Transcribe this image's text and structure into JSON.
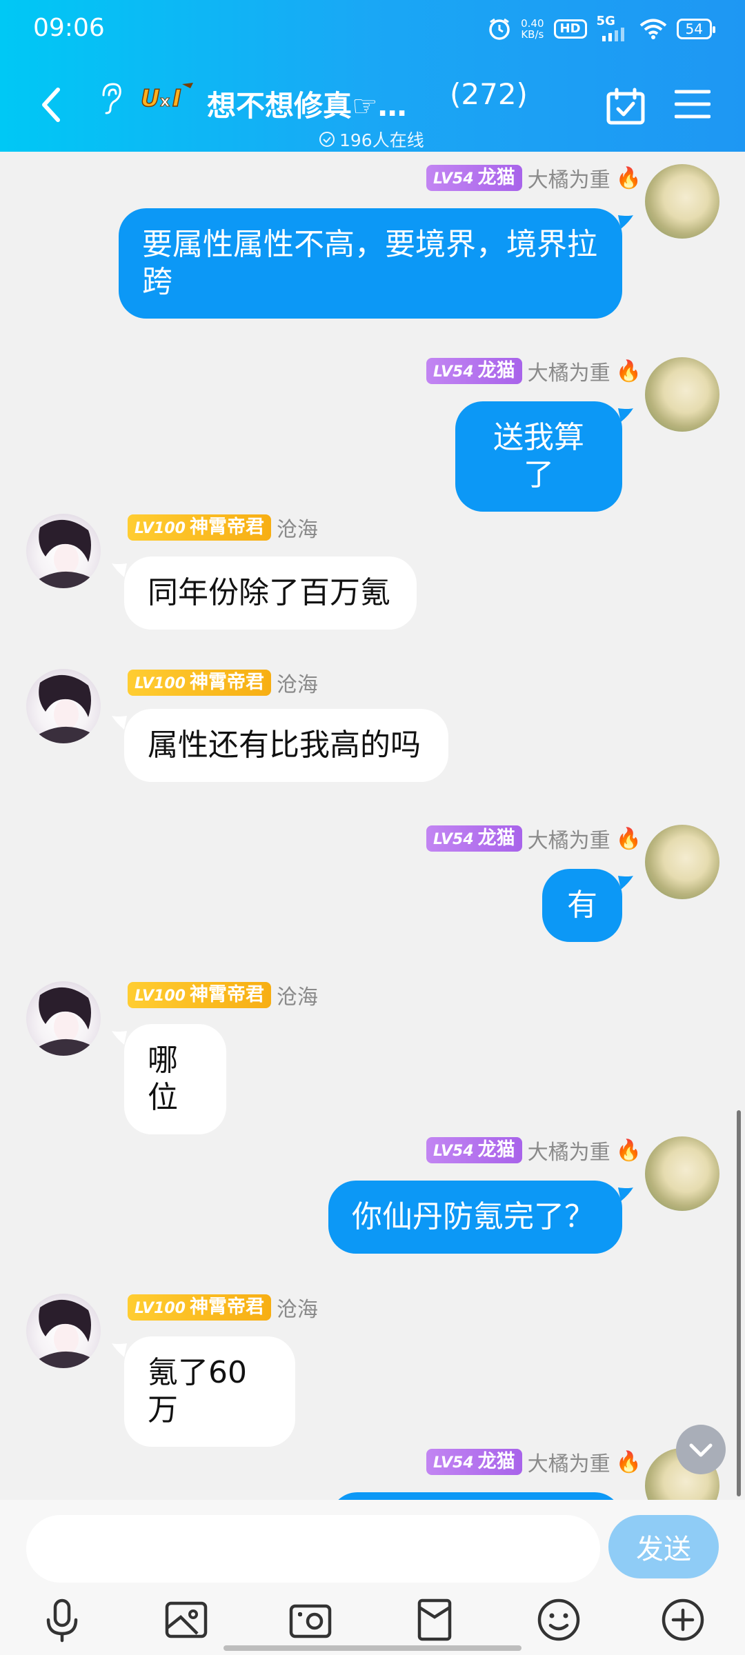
{
  "status_bar": {
    "time": "09:06",
    "net_speed_value": "0.40",
    "net_speed_unit": "KB/s",
    "hd_label": "HD",
    "signal_label": "5G",
    "battery": "54"
  },
  "header": {
    "group_title": "想不想修真☞…",
    "member_count": "(272)",
    "online_count": "196人在线",
    "logo_text": "UxI"
  },
  "messages": [
    {
      "side": "out",
      "level": "LV54",
      "title": "龙猫",
      "name": "大橘为重",
      "text": "要属性属性不高，要境界，境界拉跨"
    },
    {
      "side": "out",
      "level": "LV54",
      "title": "龙猫",
      "name": "大橘为重",
      "text": "送我算了"
    },
    {
      "side": "in",
      "level": "LV100",
      "title": "神霄帝君",
      "name": "沧海",
      "text": "同年份除了百万氪"
    },
    {
      "side": "in",
      "level": "LV100",
      "title": "神霄帝君",
      "name": "沧海",
      "text": "属性还有比我高的吗"
    },
    {
      "side": "out",
      "level": "LV54",
      "title": "龙猫",
      "name": "大橘为重",
      "text": "有"
    },
    {
      "side": "in",
      "level": "LV100",
      "title": "神霄帝君",
      "name": "沧海",
      "text": "哪位"
    },
    {
      "side": "out",
      "level": "LV54",
      "title": "龙猫",
      "name": "大橘为重",
      "text": "你仙丹防氪完了？"
    },
    {
      "side": "in",
      "level": "LV100",
      "title": "神霄帝君",
      "name": "沧海",
      "text": "氪了60万"
    },
    {
      "side": "out",
      "level": "LV54",
      "title": "龙猫",
      "name": "大橘为重",
      "text": ""
    }
  ],
  "input": {
    "placeholder": "",
    "value": "",
    "send_label": "发送"
  },
  "toolbar": [
    "mic-icon",
    "image-icon",
    "camera-icon",
    "red-packet-icon",
    "emoji-icon",
    "plus-icon"
  ],
  "colors": {
    "header_start": "#00c8f5",
    "header_end": "#1e97f3",
    "bubble_out": "#0c98f6",
    "badge_purple": "#a863ea",
    "badge_gold": "#f7ae13"
  }
}
